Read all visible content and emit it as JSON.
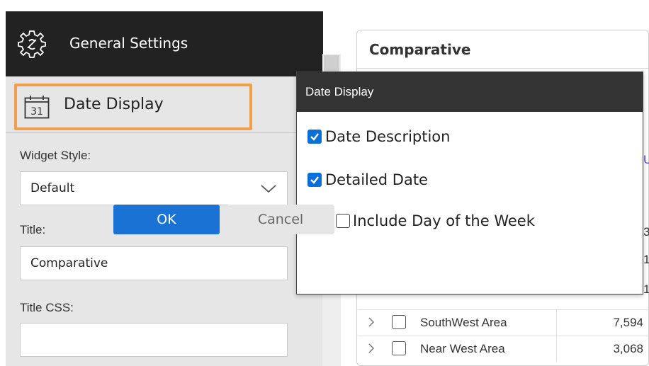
{
  "general_settings": {
    "title": "General Settings",
    "icon": "gear-icon"
  },
  "date_display_section": {
    "label": "Date Display",
    "icon": "calendar-icon",
    "calendar_day": "31",
    "highlight_color": "#f0a04b"
  },
  "form": {
    "widget_style_label": "Widget Style:",
    "widget_style_value": "Default",
    "title_label": "Title:",
    "title_value": "Comparative",
    "title_css_label": "Title CSS:",
    "title_css_value": ""
  },
  "widget": {
    "title": "Comparative",
    "partial_labels": [
      "Ur",
      "3",
      "1",
      "1"
    ],
    "rows": [
      {
        "name": "SouthWest Area",
        "value": "7,594"
      },
      {
        "name": "Near West Area",
        "value": "3,068"
      }
    ]
  },
  "dialog": {
    "title": "Date Display",
    "options": [
      {
        "label": "Date Description",
        "checked": true
      },
      {
        "label": "Detailed Date",
        "checked": true
      },
      {
        "label": "Include Day of the Week",
        "checked": false
      }
    ],
    "ok_label": "OK",
    "cancel_label": "Cancel",
    "accent": "#0a6fd6"
  }
}
